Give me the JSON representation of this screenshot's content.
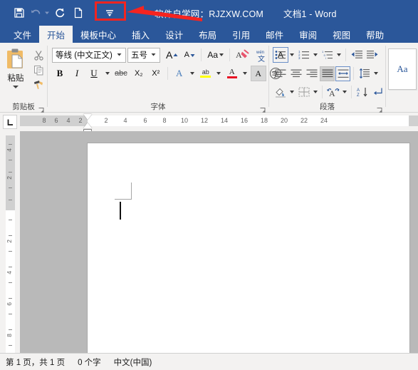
{
  "titlebar": {
    "site_title": "软件自学网：RJZXW.COM",
    "doc_title": "文档1  -  Word",
    "quick_access": [
      {
        "name": "save-icon",
        "label": "保存"
      },
      {
        "name": "undo-icon",
        "label": "撤消"
      },
      {
        "name": "redo-icon",
        "label": "重复"
      },
      {
        "name": "new-document-icon",
        "label": "新建"
      },
      {
        "name": "customize-quick-access-toolbar-icon",
        "label": "自定义快速访问工具栏"
      }
    ]
  },
  "tabs": [
    {
      "label": "文件",
      "active": false
    },
    {
      "label": "开始",
      "active": true
    },
    {
      "label": "模板中心",
      "active": false
    },
    {
      "label": "插入",
      "active": false
    },
    {
      "label": "设计",
      "active": false
    },
    {
      "label": "布局",
      "active": false
    },
    {
      "label": "引用",
      "active": false
    },
    {
      "label": "邮件",
      "active": false
    },
    {
      "label": "审阅",
      "active": false
    },
    {
      "label": "视图",
      "active": false
    },
    {
      "label": "帮助",
      "active": false
    }
  ],
  "ribbon": {
    "clipboard": {
      "group_label": "剪贴板",
      "paste_label": "粘贴",
      "cut_label": "剪切",
      "copy_label": "复制",
      "format_painter_label": "格式刷"
    },
    "font": {
      "group_label": "字体",
      "font_name_value": "等线 (中文正文)",
      "font_size_value": "五号",
      "grow_font_label": "A",
      "shrink_font_label": "A",
      "change_case_label": "Aa",
      "clear_formatting_label": "清除所有格式",
      "phonetic_guide_label": "wén 文",
      "character_border_label": "A",
      "bold_label": "B",
      "italic_label": "I",
      "underline_label": "U",
      "strikethrough_label": "abc",
      "subscript_label": "X₂",
      "superscript_label": "X²",
      "text_effects_label": "A",
      "highlight_label": "ab",
      "font_color_label": "A",
      "character_shading_label": "A",
      "enclose_characters_label": "字"
    },
    "paragraph": {
      "group_label": "段落",
      "bullets_label": "项目符号",
      "numbering_label": "编号",
      "multilevel_label": "多级列表",
      "decrease_indent_label": "减少缩进量",
      "increase_indent_label": "增加缩进量",
      "align_left_label": "左对齐",
      "align_center_label": "居中",
      "align_right_label": "右对齐",
      "justify_label": "两端对齐",
      "distribute_label": "分散对齐",
      "line_spacing_label": "行和段落间距",
      "shading_label": "底纹",
      "borders_label": "边框",
      "text_adjust_label": "中文版式",
      "sort_label": "排序",
      "show_marks_label": "显示编辑标记"
    },
    "styles": {
      "sample_label": "Aa"
    }
  },
  "ruler": {
    "tab_stop_selector": "左对齐式制表符",
    "h_numbers": [
      "8",
      "6",
      "4",
      "2",
      "2",
      "4",
      "6",
      "8",
      "10",
      "12",
      "14",
      "16",
      "18",
      "20",
      "22",
      "24"
    ],
    "v_numbers": [
      "4",
      "2",
      "2",
      "4",
      "6",
      "8"
    ]
  },
  "document": {
    "caret_visible": true,
    "margin_marker": "左上页边距标记"
  },
  "statusbar": {
    "page_info": "第 1 页，共 1 页",
    "word_count": "0 个字",
    "language": "中文(中国)"
  },
  "annotation": {
    "highlight_target": "customize-quick-access-toolbar-icon",
    "color": "#f6241f"
  },
  "colors": {
    "brand_blue": "#2b579a",
    "ribbon_bg": "#f3f2f1",
    "workspace_grey": "#b9b9b9",
    "annotation_red": "#f6241f"
  }
}
